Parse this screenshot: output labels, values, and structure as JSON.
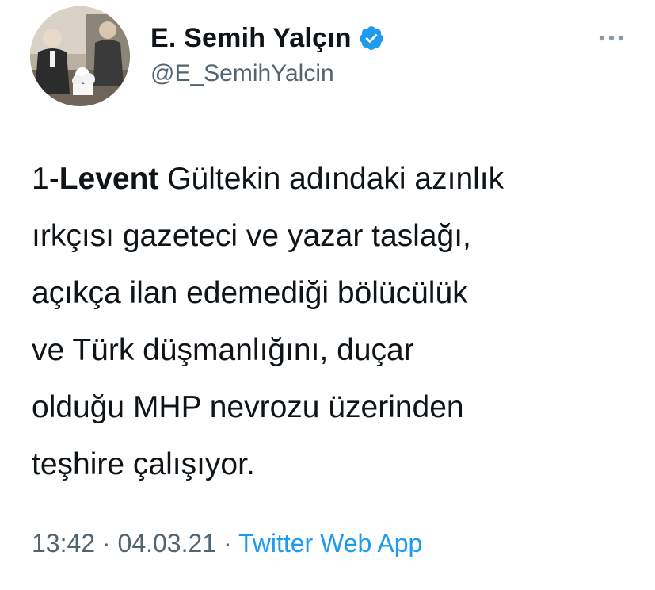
{
  "user": {
    "display_name": "E. Semih Yalçın",
    "handle": "@E_SemihYalcin",
    "verified": true,
    "avatar_icon": "profile-photo"
  },
  "menu_icon": "more-dots-icon",
  "tweet": {
    "prefix": "1-",
    "bold_word": "Levent",
    "line1_rest": " Gültekin adındaki azınlık",
    "lines": [
      "ırkçısı gazeteci ve yazar taslağı,",
      "açıkça ilan edemediği bölücülük",
      "ve Türk düşmanlığını, duçar",
      "olduğu MHP nevrozu üzerinden",
      "teşhire çalışıyor."
    ]
  },
  "meta": {
    "time": "13:42",
    "sep1": " · ",
    "date": "04.03.21",
    "sep2": " · ",
    "source": "Twitter Web App"
  },
  "colors": {
    "text": "#0f1419",
    "secondary": "#536471",
    "accent": "#1d9bf0"
  }
}
